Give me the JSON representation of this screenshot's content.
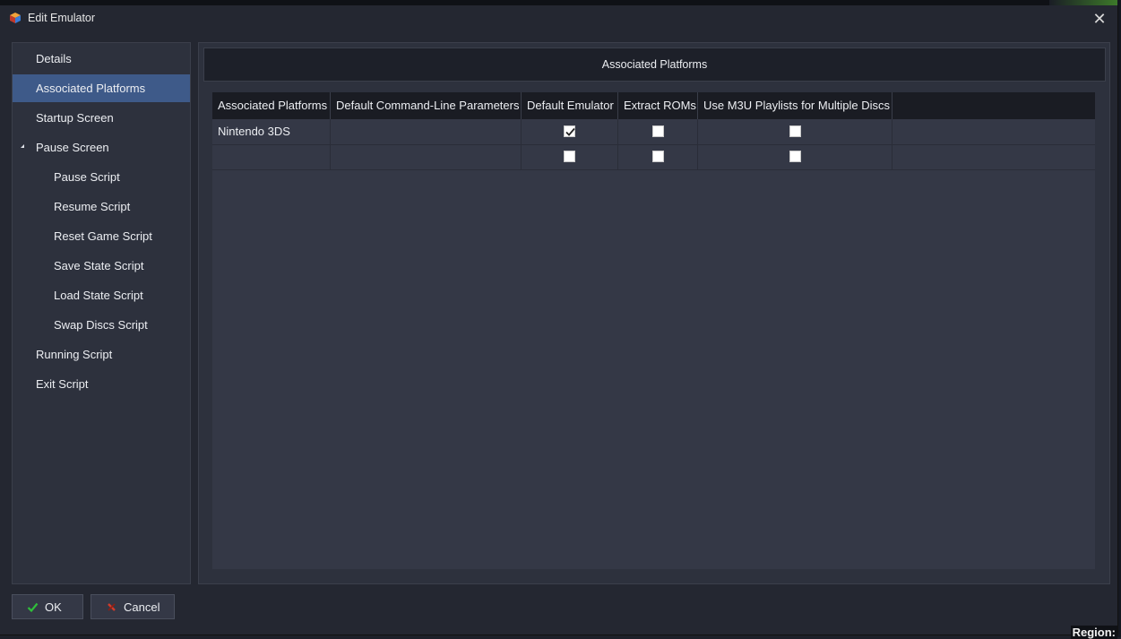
{
  "window": {
    "title": "Edit Emulator",
    "close_glyph": "✕",
    "icon": "launchbox-cube-icon"
  },
  "background": {
    "region_label": "Region:"
  },
  "nav": {
    "items": [
      {
        "label": "Details",
        "level": 1,
        "selected": false
      },
      {
        "label": "Associated Platforms",
        "level": 1,
        "selected": true
      },
      {
        "label": "Startup Screen",
        "level": 1,
        "selected": false
      },
      {
        "label": "Pause Screen",
        "level": 1,
        "selected": false,
        "expanded": true
      },
      {
        "label": "Pause Script",
        "level": 2,
        "selected": false
      },
      {
        "label": "Resume Script",
        "level": 2,
        "selected": false
      },
      {
        "label": "Reset Game Script",
        "level": 2,
        "selected": false
      },
      {
        "label": "Save State Script",
        "level": 2,
        "selected": false
      },
      {
        "label": "Load State Script",
        "level": 2,
        "selected": false
      },
      {
        "label": "Swap Discs Script",
        "level": 2,
        "selected": false
      },
      {
        "label": "Running Script",
        "level": 1,
        "selected": false
      },
      {
        "label": "Exit Script",
        "level": 1,
        "selected": false
      }
    ]
  },
  "panel": {
    "header": "Associated Platforms"
  },
  "grid": {
    "columns": [
      "Associated Platforms",
      "Default Command-Line Parameters",
      "Default Emulator",
      "Extract ROMs",
      "Use M3U Playlists for Multiple Discs"
    ],
    "rows": [
      {
        "platform": "Nintendo 3DS",
        "params": "",
        "default_emulator": true,
        "extract_roms": false,
        "use_m3u": false
      },
      {
        "platform": "",
        "params": "",
        "default_emulator": false,
        "extract_roms": false,
        "use_m3u": false
      }
    ]
  },
  "buttons": {
    "ok": {
      "label": "OK",
      "icon": "checkmark-icon",
      "color": "#2fbf3a"
    },
    "cancel": {
      "label": "Cancel",
      "icon": "cancel-x-icon",
      "color": "#d23a2a"
    }
  }
}
